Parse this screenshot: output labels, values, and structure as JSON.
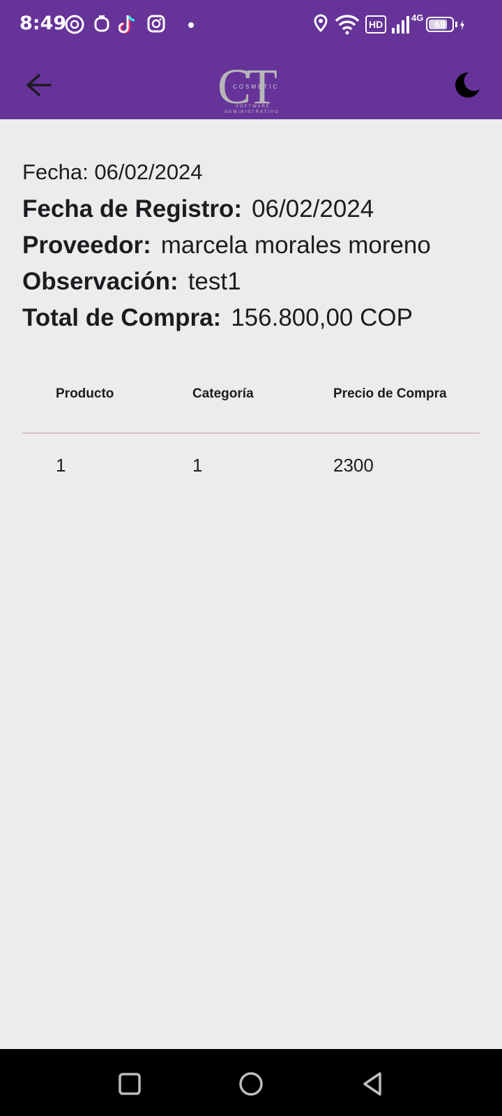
{
  "status": {
    "time": "8:49",
    "battery": "69",
    "network": "4G",
    "hd": "HD"
  },
  "app_bar": {
    "logo": {
      "initials": "CT",
      "word": "COSMETIC",
      "line1": "SOFTWARE",
      "line2": "ADMINISTRATIVO"
    }
  },
  "details": {
    "fecha": "Fecha: 06/02/2024",
    "fecha_registro_label": "Fecha de Registro:",
    "fecha_registro_value": "06/02/2024",
    "proveedor_label": "Proveedor:",
    "proveedor_value": "marcela morales moreno",
    "observacion_label": "Observación:",
    "observacion_value": "test1",
    "total_label": "Total de Compra:",
    "total_value": "156.800,00 COP"
  },
  "table": {
    "headers": [
      "Producto",
      "Categoría",
      "Precio de Compra"
    ],
    "rows": [
      [
        "1",
        "1",
        "2300"
      ]
    ]
  }
}
